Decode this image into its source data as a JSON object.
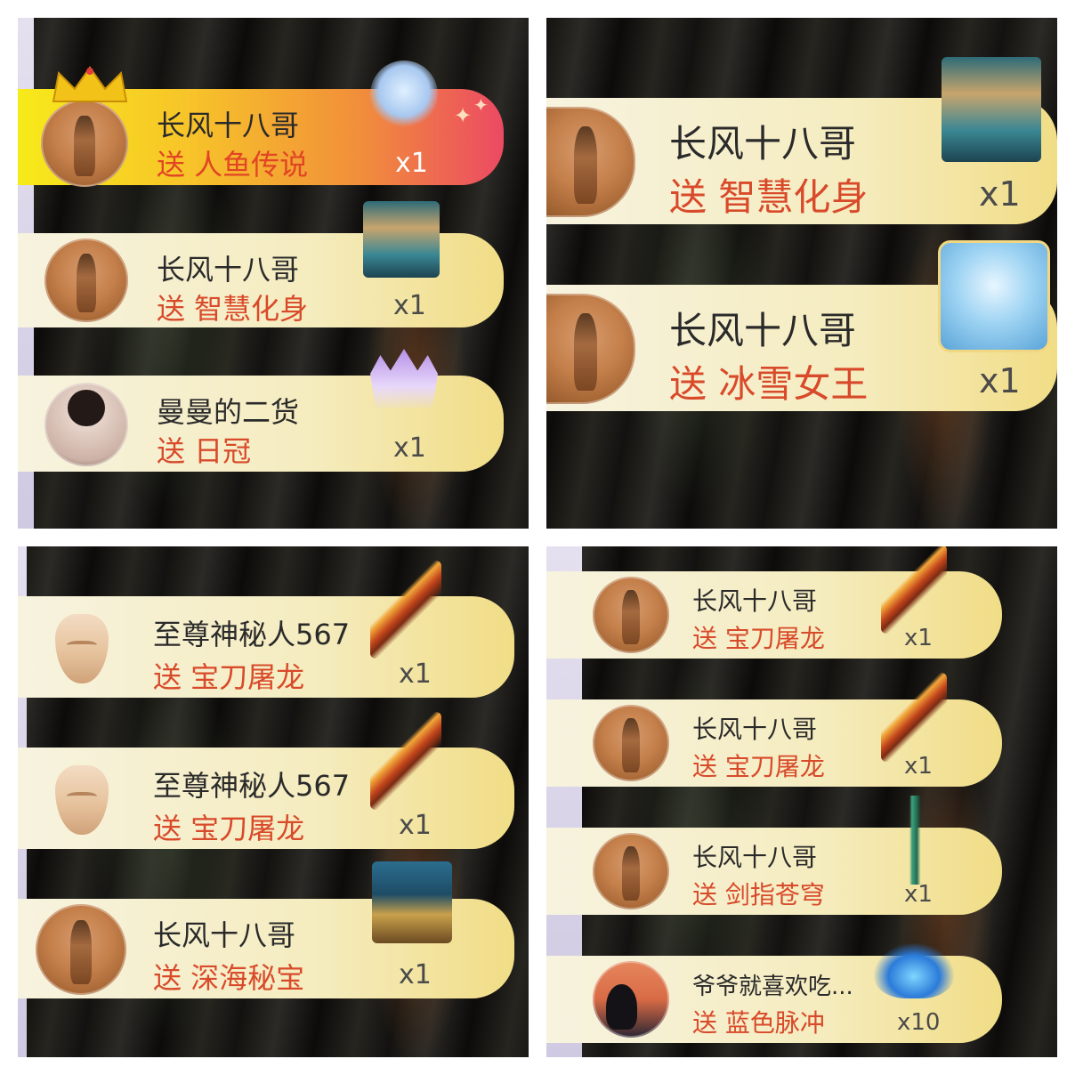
{
  "panels": [
    {
      "rows": [
        {
          "name": "长风十八哥",
          "gift": "送 人鱼传说",
          "qty": "x1",
          "gift_icon": "mermaid-legend-icon",
          "highlight": "gold"
        },
        {
          "name": "长风十八哥",
          "gift": "送 智慧化身",
          "qty": "x1",
          "gift_icon": "wisdom-avatar-icon"
        },
        {
          "name": "曼曼的二货",
          "gift": "送 日冠",
          "qty": "x1",
          "gift_icon": "sun-crown-icon"
        }
      ]
    },
    {
      "rows": [
        {
          "name": "长风十八哥",
          "gift": "送 智慧化身",
          "qty": "x1",
          "gift_icon": "wisdom-avatar-icon"
        },
        {
          "name": "长风十八哥",
          "gift": "送 冰雪女王",
          "qty": "x1",
          "gift_icon": "ice-queen-icon"
        }
      ]
    },
    {
      "rows": [
        {
          "name": "至尊神秘人567",
          "gift": "送 宝刀屠龙",
          "qty": "x1",
          "gift_icon": "dragon-blade-icon"
        },
        {
          "name": "至尊神秘人567",
          "gift": "送 宝刀屠龙",
          "qty": "x1",
          "gift_icon": "dragon-blade-icon"
        },
        {
          "name": "长风十八哥",
          "gift": "送 深海秘宝",
          "qty": "x1",
          "gift_icon": "deep-sea-treasure-icon"
        }
      ]
    },
    {
      "rows": [
        {
          "name": "长风十八哥",
          "gift": "送 宝刀屠龙",
          "qty": "x1",
          "gift_icon": "dragon-blade-icon"
        },
        {
          "name": "长风十八哥",
          "gift": "送 宝刀屠龙",
          "qty": "x1",
          "gift_icon": "dragon-blade-icon"
        },
        {
          "name": "长风十八哥",
          "gift": "送 剑指苍穹",
          "qty": "x1",
          "gift_icon": "sky-sword-icon"
        },
        {
          "name": "爷爷就喜欢吃...",
          "gift": "送 蓝色脉冲",
          "qty": "x10",
          "gift_icon": "blue-pulse-car-icon"
        }
      ]
    }
  ],
  "colors": {
    "gift_text": "#d84a2a",
    "name_text": "#2a2a2a",
    "pill_light": "#f7f3df",
    "pill_gold": "#f1dd86",
    "highlight_start": "#f7ea1a",
    "highlight_end": "#ec4a63"
  }
}
